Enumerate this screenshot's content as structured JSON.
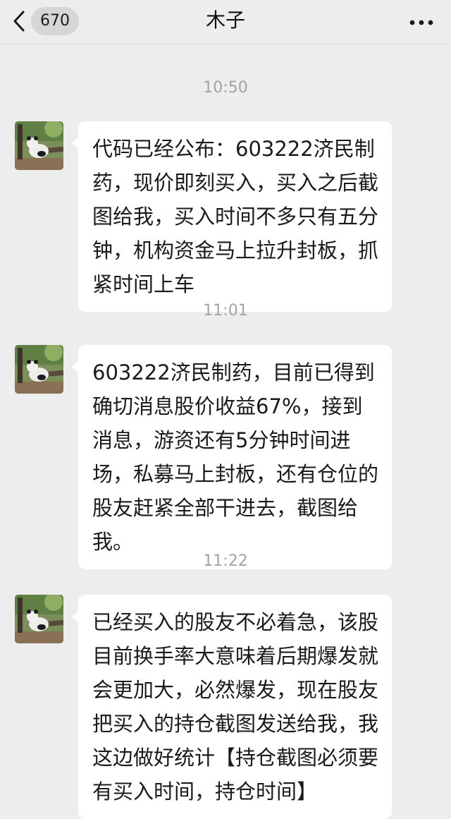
{
  "header": {
    "back_icon": "chevron-left-icon",
    "unread_count": "670",
    "title": "木子",
    "more_icon": "more-dots-icon"
  },
  "messages": [
    {
      "time": "10:50",
      "avatar_icon": "panda-photo-avatar",
      "text": "代码已经公布：603222济民制药，现价即刻买入，买入之后截图给我，买入时间不多只有五分钟，机构资金马上拉升封板，抓紧时间上车"
    },
    {
      "time": "11:01",
      "avatar_icon": "panda-photo-avatar",
      "text": "603222济民制药，目前已得到确切消息股价收益67%，接到消息，游资还有5分钟时间进场，私募马上封板，还有仓位的股友赶紧全部干进去，截图给我。"
    },
    {
      "time": "11:22",
      "avatar_icon": "panda-photo-avatar",
      "text": "已经买入的股友不必着急，该股目前换手率大意味着后期爆发就会更加大，必然爆发，现在股友把买入的持仓截图发送给我，我这边做好统计【持仓截图必须要有买入时间，持仓时间】"
    }
  ],
  "colors": {
    "background": "#ededed",
    "bubble": "#ffffff",
    "timestamp": "#a3a3a3",
    "text": "#1a1a1a"
  }
}
